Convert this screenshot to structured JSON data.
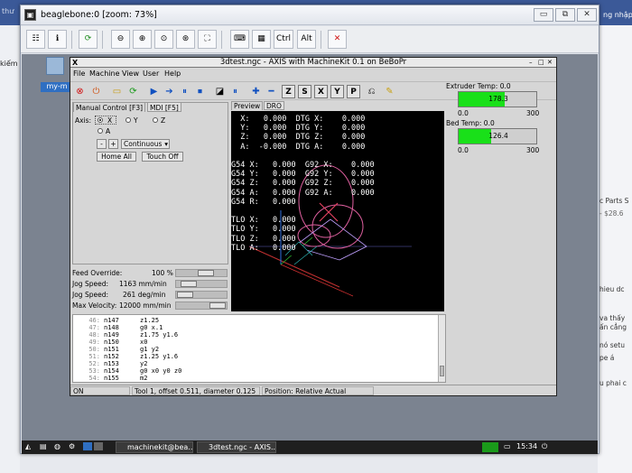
{
  "browser": {
    "tabs": [
      "thư",
      "",
      "",
      "",
      "",
      "",
      "",
      ""
    ],
    "top_right_text": "ng nhập c",
    "left_text": "kiếm",
    "right_texts": [
      "c Parts S",
      "- $28.6",
      "hieu dc",
      "va thấy",
      "ấn cẳng",
      "nó setu",
      "pe á",
      "u phai c"
    ]
  },
  "vnc": {
    "title": "beaglebone:0 [zoom: 73%]",
    "buttons": {
      "minimize": "▭",
      "restore": "⧉",
      "close": "✕"
    },
    "toolbar": {
      "ctrl": "Ctrl",
      "alt": "Alt"
    }
  },
  "desktop": {
    "icon_label": "my-m"
  },
  "axis": {
    "title": "3dtest.ngc - AXIS with MachineKit 0.1 on BeBoPr",
    "menu": [
      "File",
      "Machine",
      "View",
      "User",
      "Help"
    ],
    "toolbar_letters": [
      "Z",
      "X",
      "Y"
    ],
    "tabs": [
      "Manual Control [F3]",
      "MDI [F5]"
    ],
    "axis_label": "Axis:",
    "axes": [
      "X",
      "Y",
      "Z",
      "A"
    ],
    "jog_minus": "-",
    "jog_plus": "+",
    "jog_mode": "Continuous",
    "home_all": "Home All",
    "touch_off": "Touch Off",
    "sliders": [
      {
        "label": "Feed Override:",
        "value": "100 %",
        "position": 0.62
      },
      {
        "label": "Jog Speed:",
        "value": "1163 mm/min",
        "position": 0.12
      },
      {
        "label": "Jog Speed:",
        "value": "261 deg/min",
        "position": 0.02
      },
      {
        "label": "Max Velocity:",
        "value": "12000 mm/min",
        "position": 0.97
      }
    ],
    "preview_tabs": [
      "Preview",
      "DRO"
    ],
    "dro": [
      "  X:   0.000  DTG X:    0.000",
      "  Y:   0.000  DTG Y:    0.000",
      "  Z:   0.000  DTG Z:    0.000",
      "  A:  -0.000  DTG A:    0.000",
      "",
      "G54 X:   0.000  G92 X:    0.000",
      "G54 Y:   0.000  G92 Y:    0.000",
      "G54 Z:   0.000  G92 Z:    0.000",
      "G54 A:   0.000  G92 A:    0.000",
      "G54 R:   0.000",
      "",
      "TLO X:   0.000",
      "TLO Y:   0.000",
      "TLO Z:   0.000",
      "TLO A:   0.000"
    ],
    "extruder": {
      "label": "Extruder Temp: 0.0",
      "value": "178.3",
      "fraction": 0.594,
      "min": "0.0",
      "max": "300"
    },
    "bed": {
      "label": "Bed Temp: 0.0",
      "value": "126.4",
      "fraction": 0.421,
      "min": "0.0",
      "max": "300"
    },
    "gcode": [
      {
        "n": "46:",
        "code": "n147",
        "text": "z1.25"
      },
      {
        "n": "47:",
        "code": "n148",
        "text": "g0 x.1"
      },
      {
        "n": "48:",
        "code": "n149",
        "text": "z1.75 y1.6"
      },
      {
        "n": "49:",
        "code": "n150",
        "text": "x0"
      },
      {
        "n": "50:",
        "code": "n151",
        "text": "g1 y2"
      },
      {
        "n": "51:",
        "code": "n152",
        "text": "z1.25 y1.6"
      },
      {
        "n": "52:",
        "code": "n153",
        "text": "y2"
      },
      {
        "n": "53:",
        "code": "n154",
        "text": "g0 x0 y0 z0"
      },
      {
        "n": "54:",
        "code": "n155",
        "text": "m2"
      }
    ],
    "status": [
      "ON",
      "Tool 1, offset 0.511, diameter 0.125",
      "Position: Relative Actual"
    ]
  },
  "taskbar": {
    "items": [
      "machinekit@bea...",
      "3dtest.ngc - AXIS..."
    ],
    "clock": "15:34"
  }
}
